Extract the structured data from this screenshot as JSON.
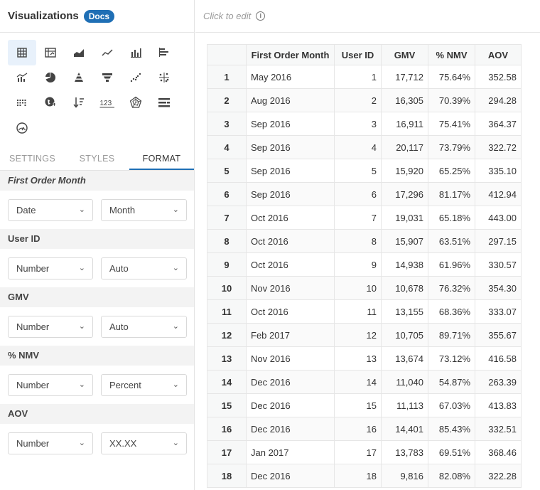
{
  "header": {
    "title": "Visualizations",
    "docs_label": "Docs"
  },
  "editor": {
    "click_to_edit": "Click to edit",
    "info_icon": "ⓘ"
  },
  "viz_icons": [
    "table-icon",
    "pivot-table-icon",
    "area-chart-icon",
    "line-chart-icon",
    "bar-chart-icon",
    "horizontal-bar-icon",
    "combo-chart-icon",
    "pie-chart-icon",
    "pyramid-icon",
    "funnel-icon",
    "scatter-icon",
    "scatter-cross-icon",
    "dot-grid-icon",
    "map-icon",
    "sort-icon",
    "number-icon",
    "radar-icon",
    "stacked-bars-icon",
    "gauge-icon"
  ],
  "tabs": [
    "SETTINGS",
    "STYLES",
    "FORMAT"
  ],
  "active_tab": "FORMAT",
  "format_sections": [
    {
      "name": "First Order Month",
      "type": "Date",
      "format": "Month"
    },
    {
      "name": "User ID",
      "type": "Number",
      "format": "Auto"
    },
    {
      "name": "GMV",
      "type": "Number",
      "format": "Auto"
    },
    {
      "name": "% NMV",
      "type": "Number",
      "format": "Percent"
    },
    {
      "name": "AOV",
      "type": "Number",
      "format": "XX.XX"
    }
  ],
  "table": {
    "columns": [
      "",
      "First Order Month",
      "User ID",
      "GMV",
      "% NMV",
      "AOV"
    ],
    "rows": [
      [
        "1",
        "May 2016",
        "1",
        "17,712",
        "75.64%",
        "352.58"
      ],
      [
        "2",
        "Aug 2016",
        "2",
        "16,305",
        "70.39%",
        "294.28"
      ],
      [
        "3",
        "Sep 2016",
        "3",
        "16,911",
        "75.41%",
        "364.37"
      ],
      [
        "4",
        "Sep 2016",
        "4",
        "20,117",
        "73.79%",
        "322.72"
      ],
      [
        "5",
        "Sep 2016",
        "5",
        "15,920",
        "65.25%",
        "335.10"
      ],
      [
        "6",
        "Sep 2016",
        "6",
        "17,296",
        "81.17%",
        "412.94"
      ],
      [
        "7",
        "Oct 2016",
        "7",
        "19,031",
        "65.18%",
        "443.00"
      ],
      [
        "8",
        "Oct 2016",
        "8",
        "15,907",
        "63.51%",
        "297.15"
      ],
      [
        "9",
        "Oct 2016",
        "9",
        "14,938",
        "61.96%",
        "330.57"
      ],
      [
        "10",
        "Nov 2016",
        "10",
        "10,678",
        "76.32%",
        "354.30"
      ],
      [
        "11",
        "Oct 2016",
        "11",
        "13,155",
        "68.36%",
        "333.07"
      ],
      [
        "12",
        "Feb 2017",
        "12",
        "10,705",
        "89.71%",
        "355.67"
      ],
      [
        "13",
        "Nov 2016",
        "13",
        "13,674",
        "73.12%",
        "416.58"
      ],
      [
        "14",
        "Dec 2016",
        "14",
        "11,040",
        "54.87%",
        "263.39"
      ],
      [
        "15",
        "Dec 2016",
        "15",
        "11,113",
        "67.03%",
        "413.83"
      ],
      [
        "16",
        "Dec 2016",
        "16",
        "14,401",
        "85.43%",
        "332.51"
      ],
      [
        "17",
        "Jan 2017",
        "17",
        "13,783",
        "69.51%",
        "368.46"
      ],
      [
        "18",
        "Dec 2016",
        "18",
        "9,816",
        "82.08%",
        "322.28"
      ]
    ]
  },
  "colors": {
    "accent": "#1f6fb5",
    "selected_bg": "#e8f1fb",
    "section_bg": "#f3f3f3",
    "header_bg": "#f7f8f8"
  }
}
